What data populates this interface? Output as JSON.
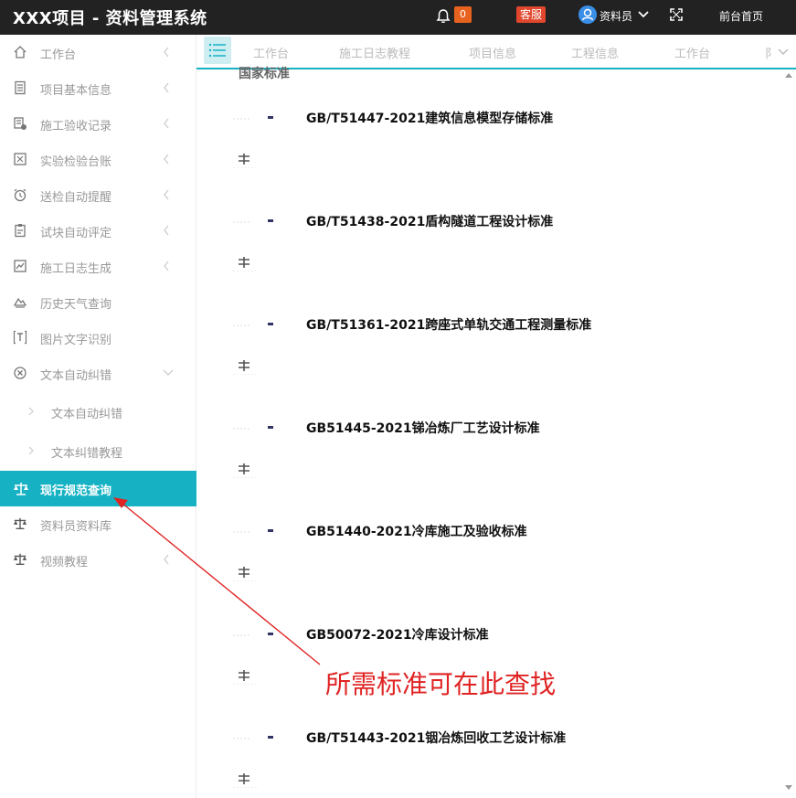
{
  "header": {
    "app_title": "XXX项目 - 资料管理系统",
    "notification_count": "0",
    "service_label": "客服",
    "user_name": "资料员",
    "front_page_label": "前台首页",
    "colors": {
      "bar": "#222222",
      "badge": "#e8621f",
      "service": "#e0472c",
      "avatar": "#3a8ee6"
    }
  },
  "sidebar": {
    "items": [
      {
        "label": "工作台",
        "icon": "home-icon"
      },
      {
        "label": "项目基本信息",
        "icon": "document-icon"
      },
      {
        "label": "施工验收记录",
        "icon": "record-icon"
      },
      {
        "label": "实验检验台账",
        "icon": "ledger-icon"
      },
      {
        "label": "送检自动提醒",
        "icon": "alarm-clock-icon"
      },
      {
        "label": "试块自动评定",
        "icon": "clipboard-icon"
      },
      {
        "label": "施工日志生成",
        "icon": "chart-log-icon"
      },
      {
        "label": "历史天气查询",
        "icon": "weather-icon"
      },
      {
        "label": "图片文字识别",
        "icon": "text-recognition-icon"
      },
      {
        "label": "文本自动纠错",
        "icon": "error-correction-icon"
      }
    ],
    "sub_items": [
      {
        "label": "文本自动纠错"
      },
      {
        "label": "文本纠错教程"
      }
    ],
    "active_item": {
      "label": "现行规范查询",
      "icon": "scale-icon"
    },
    "after_items": [
      {
        "label": "资料员资料库",
        "icon": "scale-icon"
      },
      {
        "label": "视频教程",
        "icon": "scale-icon"
      }
    ],
    "accent_color": "#16b2c4"
  },
  "tabs": {
    "items": [
      {
        "label": "工作台"
      },
      {
        "label": "施工日志教程"
      },
      {
        "label": "项目信息"
      },
      {
        "label": "工程信息"
      },
      {
        "label": "工作台"
      }
    ],
    "more_label": "阝"
  },
  "content": {
    "section_title": "国家标准",
    "standards": [
      {
        "title": "GB/T51447-2021建筑信息模型存储标准"
      },
      {
        "title": "GB/T51438-2021盾构隧道工程设计标准"
      },
      {
        "title": "GB/T51361-2021跨座式单轨交通工程测量标准"
      },
      {
        "title": "GB51445-2021锑冶炼厂工艺设计标准"
      },
      {
        "title": "GB51440-2021冷库施工及验收标准"
      },
      {
        "title": "GB50072-2021冷库设计标准"
      },
      {
        "title": "GB/T51443-2021铟冶炼回收工艺设计标准"
      }
    ]
  },
  "annotation": {
    "text": "所需标准可在此查找",
    "color": "#e02424"
  }
}
